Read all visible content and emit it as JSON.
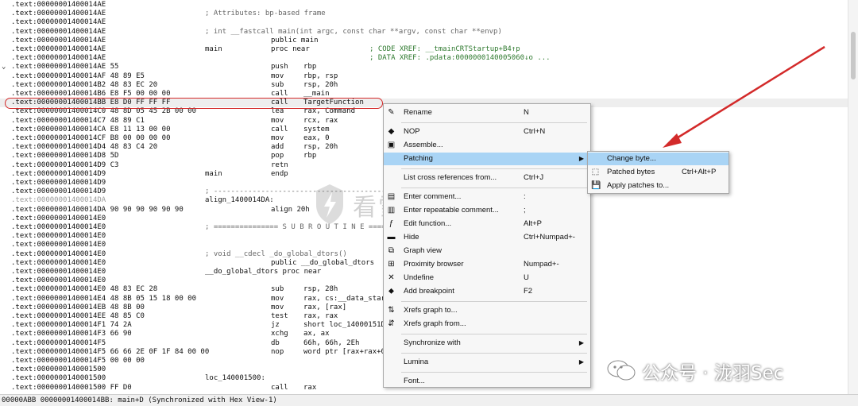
{
  "disassembly": {
    "rows": [
      {
        "addr": ".text:00000001400014AE"
      },
      {
        "addr": ".text:00000001400014AE",
        "cmt": "; Attributes: bp-based frame"
      },
      {
        "addr": ".text:00000001400014AE"
      },
      {
        "addr": ".text:00000001400014AE",
        "cmt": "; int __fastcall main(int argc, const char **argv, const char **envp)"
      },
      {
        "addr": ".text:00000001400014AE",
        "mn": "public main"
      },
      {
        "addr": ".text:00000001400014AE",
        "lbl": "main",
        "mn": "proc near",
        "xref": "; CODE XREF: __tmainCRTStartup+B4↑p"
      },
      {
        "addr": ".text:00000001400014AE",
        "xref": "; DATA XREF: .pdata:00000001400050​60↓o ..."
      },
      {
        "addr": ".text:00000001400014AE 55",
        "mn": "push",
        "op": "rbp",
        "pipe": "⌄"
      },
      {
        "addr": ".text:00000001400014AF 48 89 E5",
        "mn": "mov",
        "op": "rbp, rsp"
      },
      {
        "addr": ".text:00000001400014B2 48 83 EC 20",
        "mn": "sub",
        "op": "rsp, 20h"
      },
      {
        "addr": ".text:00000001400014B6 E8 F5 00 00 00",
        "mn": "call",
        "op": "__main"
      },
      {
        "addr": ".text:00000001400014BB E8 D0 FF FF FF",
        "mn": "call",
        "op": "TargetFunction",
        "hl": true
      },
      {
        "addr": ".text:00000001400014C0 48 8D 05 45 2B 00 00",
        "mn": "lea",
        "op": "rax, Command"
      },
      {
        "addr": ".text:00000001400014C7 48 89 C1",
        "mn": "mov",
        "op": "rcx, rax"
      },
      {
        "addr": ".text:00000001400014CA E8 11 13 00 00",
        "mn": "call",
        "op": "system"
      },
      {
        "addr": ".text:00000001400014CF B8 00 00 00 00",
        "mn": "mov",
        "op": "eax, 0"
      },
      {
        "addr": ".text:00000001400014D4 48 83 C4 20",
        "mn": "add",
        "op": "rsp, 20h"
      },
      {
        "addr": ".text:00000001400014D8 5D",
        "mn": "pop",
        "op": "rbp"
      },
      {
        "addr": ".text:00000001400014D9 C3",
        "mn": "retn"
      },
      {
        "addr": ".text:00000001400014D9",
        "lbl": "main",
        "mn": "endp"
      },
      {
        "addr": ".text:00000001400014D9"
      },
      {
        "addr": ".text:00000001400014D9",
        "cmt": "; ---------------------------------------------------------------------------"
      },
      {
        "addr": ".text:00000001400014DA",
        "lbl": "align_1400014DA:",
        "grey": true
      },
      {
        "addr": ".text:00000001400014DA 90 90 90 90 90 90",
        "mn": "align 20h"
      },
      {
        "addr": ".text:00000001400014E0"
      },
      {
        "addr": ".text:00000001400014E0",
        "cmt": "; =============== S U B R O U T I N E ======================================="
      },
      {
        "addr": ".text:00000001400014E0"
      },
      {
        "addr": ".text:00000001400014E0"
      },
      {
        "addr": ".text:00000001400014E0",
        "cmt": "; void __cdecl _do_global_dtors()"
      },
      {
        "addr": ".text:00000001400014E0",
        "mn": "public __do_global_dtors"
      },
      {
        "addr": ".text:00000001400014E0",
        "lbl": "__do_global_dtors proc near"
      },
      {
        "addr": ".text:00000001400014E0"
      },
      {
        "addr": ".text:00000001400014E0 48 83 EC 28",
        "mn": "sub",
        "op": "rsp, 28h"
      },
      {
        "addr": ".text:00000001400014E4 48 8B 05 15 18 00 00",
        "mn": "mov",
        "op": "rax, cs:__data_star"
      },
      {
        "addr": ".text:00000001400014EB 48 8B 00",
        "mn": "mov",
        "op": "rax, [rax]"
      },
      {
        "addr": ".text:00000001400014EE 48 85 C0",
        "mn": "test",
        "op": "rax, rax"
      },
      {
        "addr": ".text:00000001400014F1 74 2A",
        "mn": "jz",
        "op": "short loc_14000151D"
      },
      {
        "addr": ".text:00000001400014F3 66 90",
        "mn": "xchg",
        "op": "ax, ax"
      },
      {
        "addr": ".text:00000001400014F5",
        "mn": "db",
        "op": "66h, 66h, 2Eh"
      },
      {
        "addr": ".text:00000001400014F5 66 66 2E 0F 1F 84 00 00",
        "mn": "nop",
        "op": "word ptr [rax+rax+0"
      },
      {
        "addr": ".text:00000001400014F5 00 00 00"
      },
      {
        "addr": ".text:0000000140001500"
      },
      {
        "addr": ".text:0000000140001500",
        "lbl": "loc_140001500:"
      },
      {
        "addr": ".text:0000000140001500 FF D0",
        "mn": "call",
        "op": "rax"
      }
    ]
  },
  "context_menu": {
    "items": [
      {
        "icon": "rename-icon",
        "glyph": "✎",
        "label": "Rename",
        "shortcut": "N"
      },
      {
        "sep": true
      },
      {
        "icon": "nop-icon",
        "glyph": "◆",
        "label": "NOP",
        "shortcut": "Ctrl+N"
      },
      {
        "icon": "assemble-icon",
        "glyph": "▣",
        "label": "Assemble..."
      },
      {
        "icon": "",
        "glyph": "",
        "label": "Patching",
        "submenu": true,
        "selected": true
      },
      {
        "sep": true
      },
      {
        "icon": "",
        "glyph": "",
        "label": "List cross references from...",
        "shortcut": "Ctrl+J"
      },
      {
        "sep": true
      },
      {
        "icon": "comment-icon",
        "glyph": "▤",
        "label": "Enter comment...",
        "shortcut": ":"
      },
      {
        "icon": "repeatable-comment-icon",
        "glyph": "▥",
        "label": "Enter repeatable comment...",
        "shortcut": ";"
      },
      {
        "icon": "function-icon",
        "glyph": "ƒ",
        "label": "Edit function...",
        "shortcut": "Alt+P"
      },
      {
        "icon": "hide-icon",
        "glyph": "▬",
        "label": "Hide",
        "shortcut": "Ctrl+Numpad+-"
      },
      {
        "icon": "graph-view-icon",
        "glyph": "⧉",
        "label": "Graph view"
      },
      {
        "icon": "proximity-browser-icon",
        "glyph": "⊞",
        "label": "Proximity browser",
        "shortcut": "Numpad+-"
      },
      {
        "icon": "undefine-icon",
        "glyph": "✕",
        "label": "Undefine",
        "shortcut": "U"
      },
      {
        "icon": "breakpoint-icon",
        "glyph": "⬥",
        "label": "Add breakpoint",
        "shortcut": "F2"
      },
      {
        "sep": true
      },
      {
        "icon": "xrefs-to-icon",
        "glyph": "⇅",
        "label": "Xrefs graph to..."
      },
      {
        "icon": "xrefs-from-icon",
        "glyph": "⇵",
        "label": "Xrefs graph from..."
      },
      {
        "sep": true
      },
      {
        "icon": "",
        "glyph": "",
        "label": "Synchronize with",
        "submenu": true
      },
      {
        "sep": true
      },
      {
        "icon": "",
        "glyph": "",
        "label": "Lumina",
        "submenu": true
      },
      {
        "sep": true
      },
      {
        "icon": "",
        "glyph": "",
        "label": "Font..."
      }
    ]
  },
  "submenu": {
    "items": [
      {
        "icon": "",
        "glyph": "",
        "label": "Change byte...",
        "selected": true
      },
      {
        "icon": "patched-bytes-icon",
        "glyph": "⬚",
        "label": "Patched bytes",
        "shortcut": "Ctrl+Alt+P"
      },
      {
        "icon": "apply-patches-icon",
        "glyph": "💾",
        "label": "Apply patches to..."
      }
    ]
  },
  "status_bar": {
    "text": "00000ABB 00000001400014BB: main+D (Synchronized with Hex View-1)"
  },
  "watermark": {
    "text": "看雪安全社区"
  },
  "brand": {
    "text": "公众号 · 泷羽Sec"
  },
  "colors": {
    "annotation": "#d32a2a",
    "selection": "#a9d4f5",
    "xref": "#2f7a2f"
  }
}
